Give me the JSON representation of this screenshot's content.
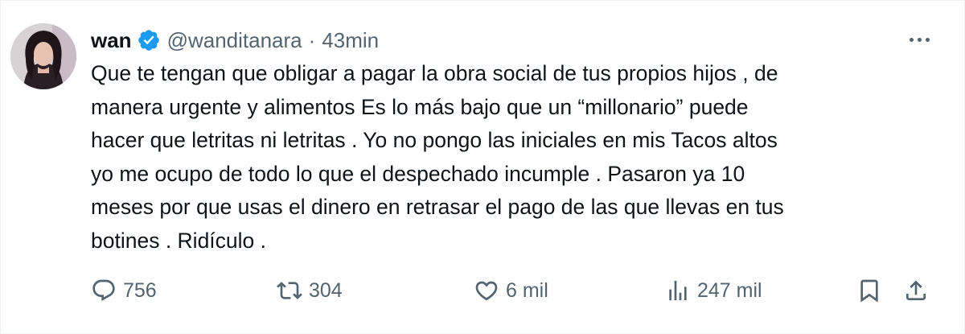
{
  "tweet": {
    "display_name": "wan",
    "handle": "@wanditanara",
    "separator": "·",
    "time": "43min",
    "text": "Que te tengan que obligar a pagar la obra social de tus propios hijos , de\nmanera urgente y alimentos  Es lo más bajo que un “millonario” puede\nhacer que letritas ni letritas .    Yo no pongo las iniciales en mis Tacos altos\nyo me ocupo de todo lo que el despechado incumple .  Pasaron ya 10\nmeses por que usas el dinero en retrasar el pago de las que llevas en tus\nbotines .  Ridículo ."
  },
  "actions": {
    "replies": "756",
    "retweets": "304",
    "likes": "6 mil",
    "views": "247 mil"
  },
  "icons": {
    "verified": "verified-badge-icon",
    "more": "more-icon",
    "reply": "reply-icon",
    "retweet": "retweet-icon",
    "like": "heart-icon",
    "views": "views-icon",
    "bookmark": "bookmark-icon",
    "share": "share-icon"
  },
  "colors": {
    "verified_blue": "#1d9bf0",
    "secondary_text": "#536471",
    "primary_text": "#0f1419"
  }
}
